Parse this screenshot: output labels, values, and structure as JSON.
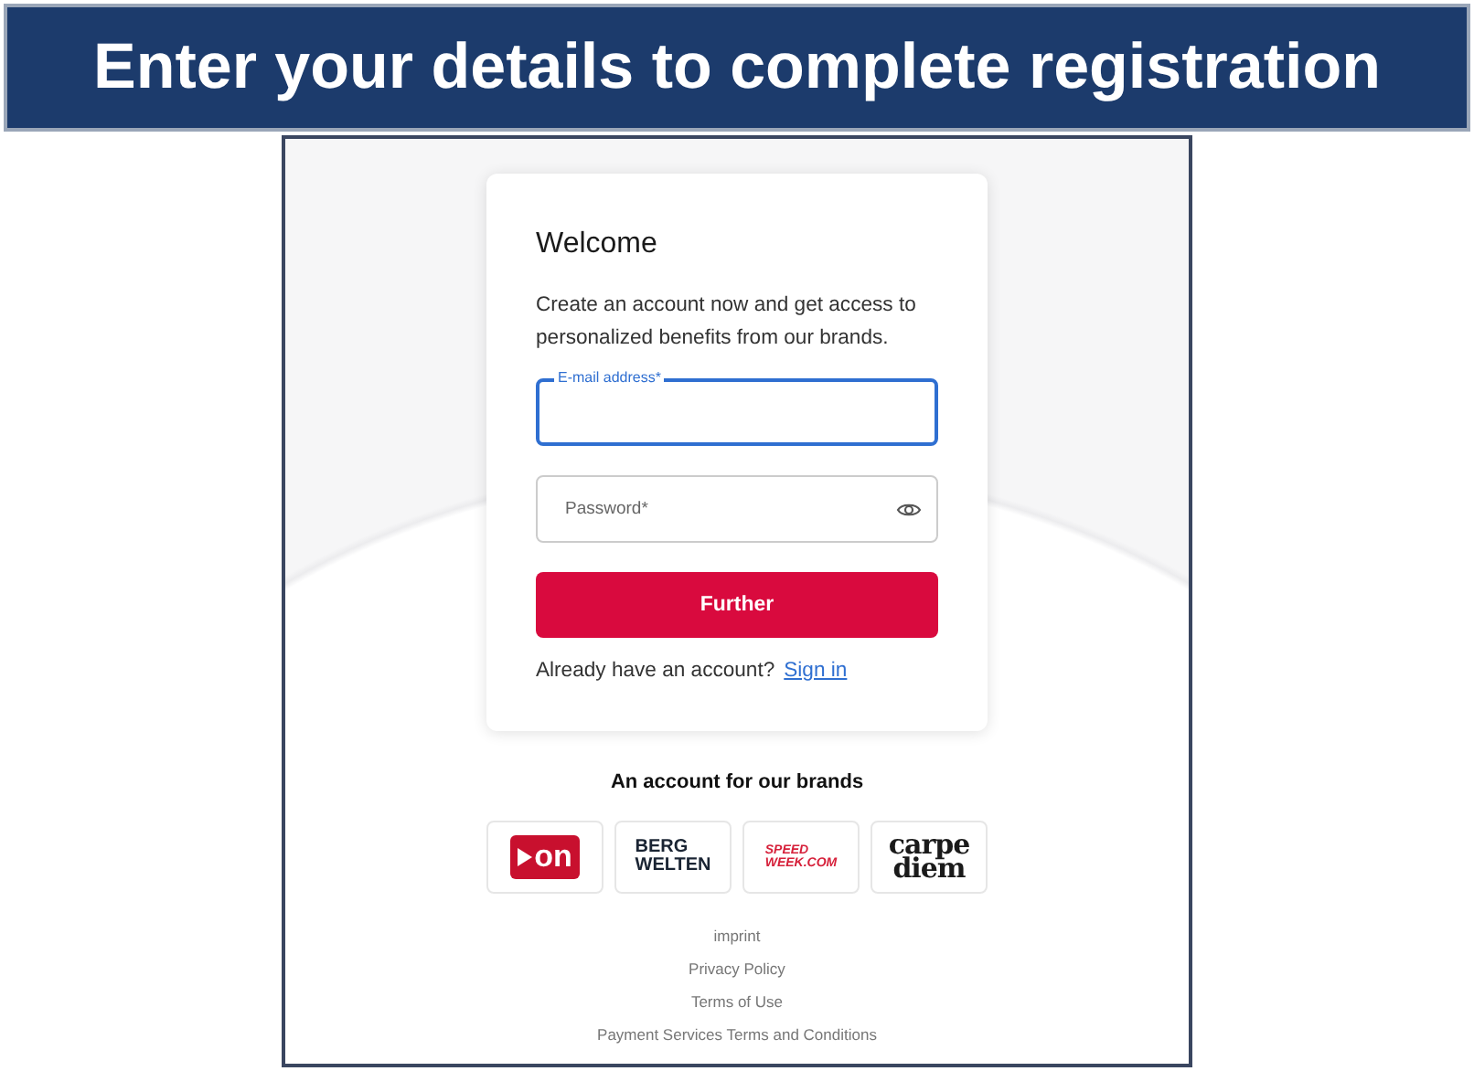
{
  "banner": {
    "title": "Enter your details to complete registration"
  },
  "card": {
    "title": "Welcome",
    "intro": "Create an account now and get access to personalized benefits from our brands.",
    "fields": [
      {
        "kind": "email",
        "label": "E-mail address*",
        "focused": true
      },
      {
        "kind": "password",
        "label": "Password*",
        "focused": false
      }
    ],
    "submit": "Further",
    "signin_prompt": "Already have an account?",
    "signin_link": "Sign in"
  },
  "brands": {
    "heading": "An account for our brands",
    "items": [
      {
        "kind": "on",
        "lines": [
          "on"
        ]
      },
      {
        "kind": "bergwelten",
        "lines": [
          "BERG",
          "WELTEN"
        ]
      },
      {
        "kind": "speedweek",
        "lines": [
          "SPEED",
          "WEEK.COM"
        ]
      },
      {
        "kind": "carpediem",
        "lines": [
          "carpe",
          "diem"
        ]
      }
    ]
  },
  "footer_links": [
    "imprint",
    "Privacy Policy",
    "Terms of Use",
    "Payment Services Terms and Conditions"
  ]
}
